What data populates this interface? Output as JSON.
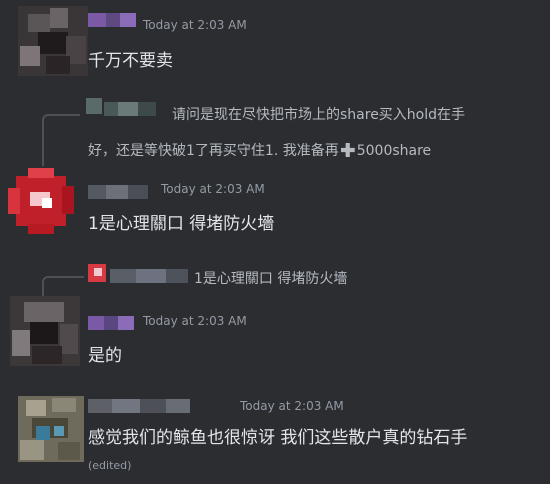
{
  "messages": [
    {
      "time": "Today at 2:03 AM",
      "text": "千万不要卖"
    },
    {
      "reply": {
        "line1": "请问是现在尽快把市场上的share买入hold在手",
        "line2_pre": "好，还是等快破1了再买守住1. 我准备再",
        "line2_post": "5000share",
        "plus_icon": "heavy-plus-icon"
      },
      "time": "Today at 2:03 AM",
      "text": "1是心理關口 得堵防火墻"
    },
    {
      "reply": {
        "text": "1是心理關口 得堵防火墻"
      },
      "time": "Today at 2:03 AM",
      "text": "是的"
    },
    {
      "time": "Today at 2:03 AM",
      "text": "感觉我们的鲸鱼也很惊讶 我们这些散户真的钻石手",
      "edited": "(edited)"
    }
  ]
}
